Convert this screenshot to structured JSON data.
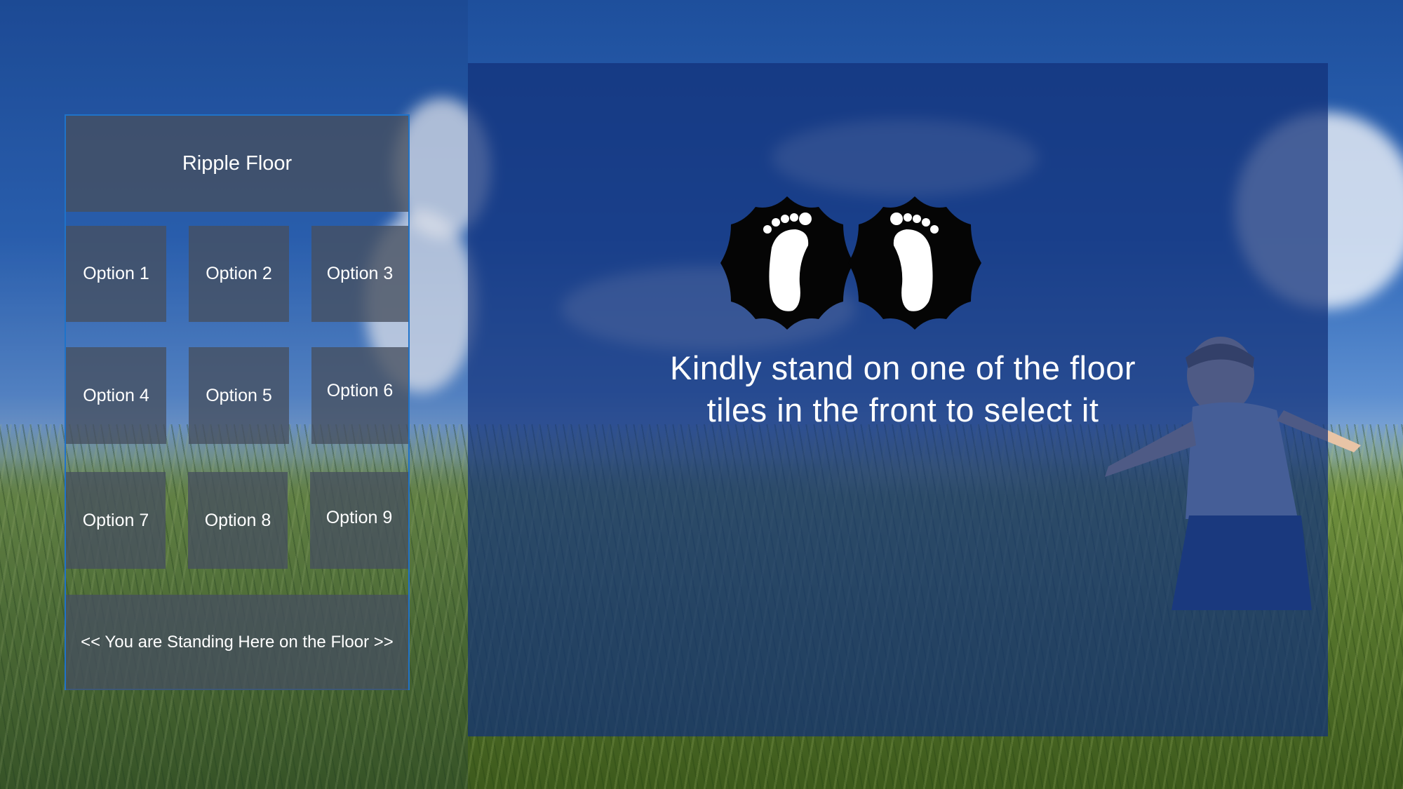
{
  "menu": {
    "title": "Ripple Floor",
    "options": [
      "Option 1",
      "Option 2",
      "Option 3",
      "Option 4",
      "Option 5",
      "Option 6",
      "Option 7",
      "Option 8",
      "Option 9"
    ],
    "footer": "<< You are Standing Here on the Floor >>"
  },
  "prompt": {
    "icon": "footprints-icon",
    "text": "Kindly stand on one of the floor tiles in the front to select it"
  },
  "colors": {
    "panel_border": "#1f73c9",
    "tile": "#46505f",
    "overlay": "#123078"
  }
}
